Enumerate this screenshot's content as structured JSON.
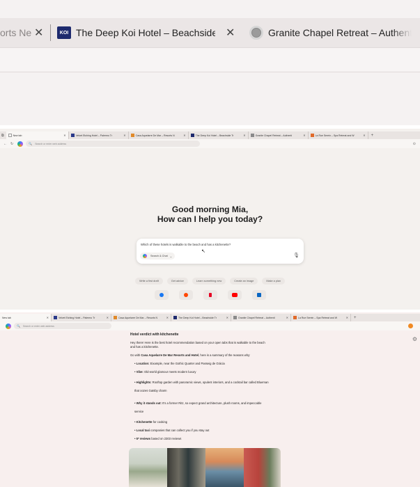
{
  "zoom_strip": {
    "tabs": [
      {
        "title": "orts Ne",
        "favicon": "partial-tab",
        "close": "✕"
      },
      {
        "title": "The Deep Koi Hotel – Beachside Tra",
        "favicon": "koi-logo",
        "favicon_text": "KOI",
        "close": "✕"
      },
      {
        "title": "Granite Chapel Retreat – Authentic",
        "favicon": "granite-logo"
      }
    ]
  },
  "browser_top": {
    "tabs": [
      {
        "title": "New tab",
        "active": true,
        "color": "#ffffff"
      },
      {
        "title": "Velvet Etching Hotel – Palermo Tr",
        "color": "#2a3a8a"
      },
      {
        "title": "Casa Aquelarre De Mar – Resorts N",
        "color": "#e08a2a"
      },
      {
        "title": "The Deep Koi Hotel – Beachside Tr",
        "color": "#1e2a6e"
      },
      {
        "title": "Granite Chapel Retreat – Authenti",
        "color": "#8a8a8a"
      },
      {
        "title": "La Rue Serein – Spa Retreat and W",
        "color": "#e06a2a"
      }
    ],
    "tab_close": "✕",
    "new_tab": "+",
    "address_placeholder": "Search or enter web address",
    "nav": {
      "back": "←",
      "refresh": "↻"
    }
  },
  "newtab": {
    "greeting_line1": "Good morning Mia,",
    "greeting_line2": "How can I help you today?",
    "query": "Which of these hotels is walkable to the beach and has a kitchenette?",
    "mode": "Search & Chat",
    "mode_caret": "⌄",
    "mic": "🎙",
    "cursor": "↖",
    "chips": [
      "Write a first draft",
      "Get advice",
      "Learn something new",
      "Create an image",
      "Make a plan"
    ],
    "quick_links": [
      {
        "name": "facebook",
        "color": "#1877f2"
      },
      {
        "name": "reddit",
        "color": "#ff4500"
      },
      {
        "name": "pinterest",
        "color": "#e60023"
      },
      {
        "name": "youtube",
        "color": "#ff0000"
      },
      {
        "name": "linkedin",
        "color": "#0a66c2"
      }
    ]
  },
  "browser_bottom": {
    "tabs": [
      {
        "title": "New tab",
        "active": true,
        "color": "#ffffff"
      },
      {
        "title": "Velvet Etching Hotel – Palermo Tr",
        "color": "#2a3a8a"
      },
      {
        "title": "Casa Aquelarre De Mar – Resorts N",
        "color": "#e08a2a"
      },
      {
        "title": "The Deep Koi Hotel – Beachside Tr",
        "color": "#1e2a6e"
      },
      {
        "title": "Granite Chapel Retreat – Authenti",
        "color": "#8a8a8a"
      },
      {
        "title": "La Rue Serein – Spa Retreat and W",
        "color": "#e06a2a"
      }
    ],
    "address_placeholder": "Search or enter web address"
  },
  "answer": {
    "heading": "Hotel verdict with kitchenette",
    "intro": "Hey there! Here is the best hotel recommendation based on your open tabs that is walkable to the beach and has a kitchenette.",
    "go_with_prefix": "Go with ",
    "go_with_hotel": "Casa Aquelarre De Mar Resorts and Hotel",
    "go_with_suffix": ", here is a summary of the reasons why:",
    "bullets": [
      {
        "label": "Location:",
        "text": " Eixample, near the Gothic Quarter and Passeig de Gràcia"
      },
      {
        "label": "Vibe:",
        "text": " Old-world glamour meets modern luxury"
      },
      {
        "label": "Highlights:",
        "text": " Rooftop garden with panoramic views, opulent interiors, and a cocktail bar called Blueman that oozes Gatsby charm"
      },
      {
        "label": "Why it stands out:",
        "text": " It's a former Ritz, so expect grand architecture, plush rooms, and impeccable service"
      },
      {
        "label": "Kitchenette",
        "text": " for cooking"
      },
      {
        "label": "Local taxi",
        "text": " companies that can collect you if you stay out"
      },
      {
        "label": "5* reviews",
        "text": " based on 2303 reviews"
      }
    ],
    "settings_icon": "⚙"
  }
}
